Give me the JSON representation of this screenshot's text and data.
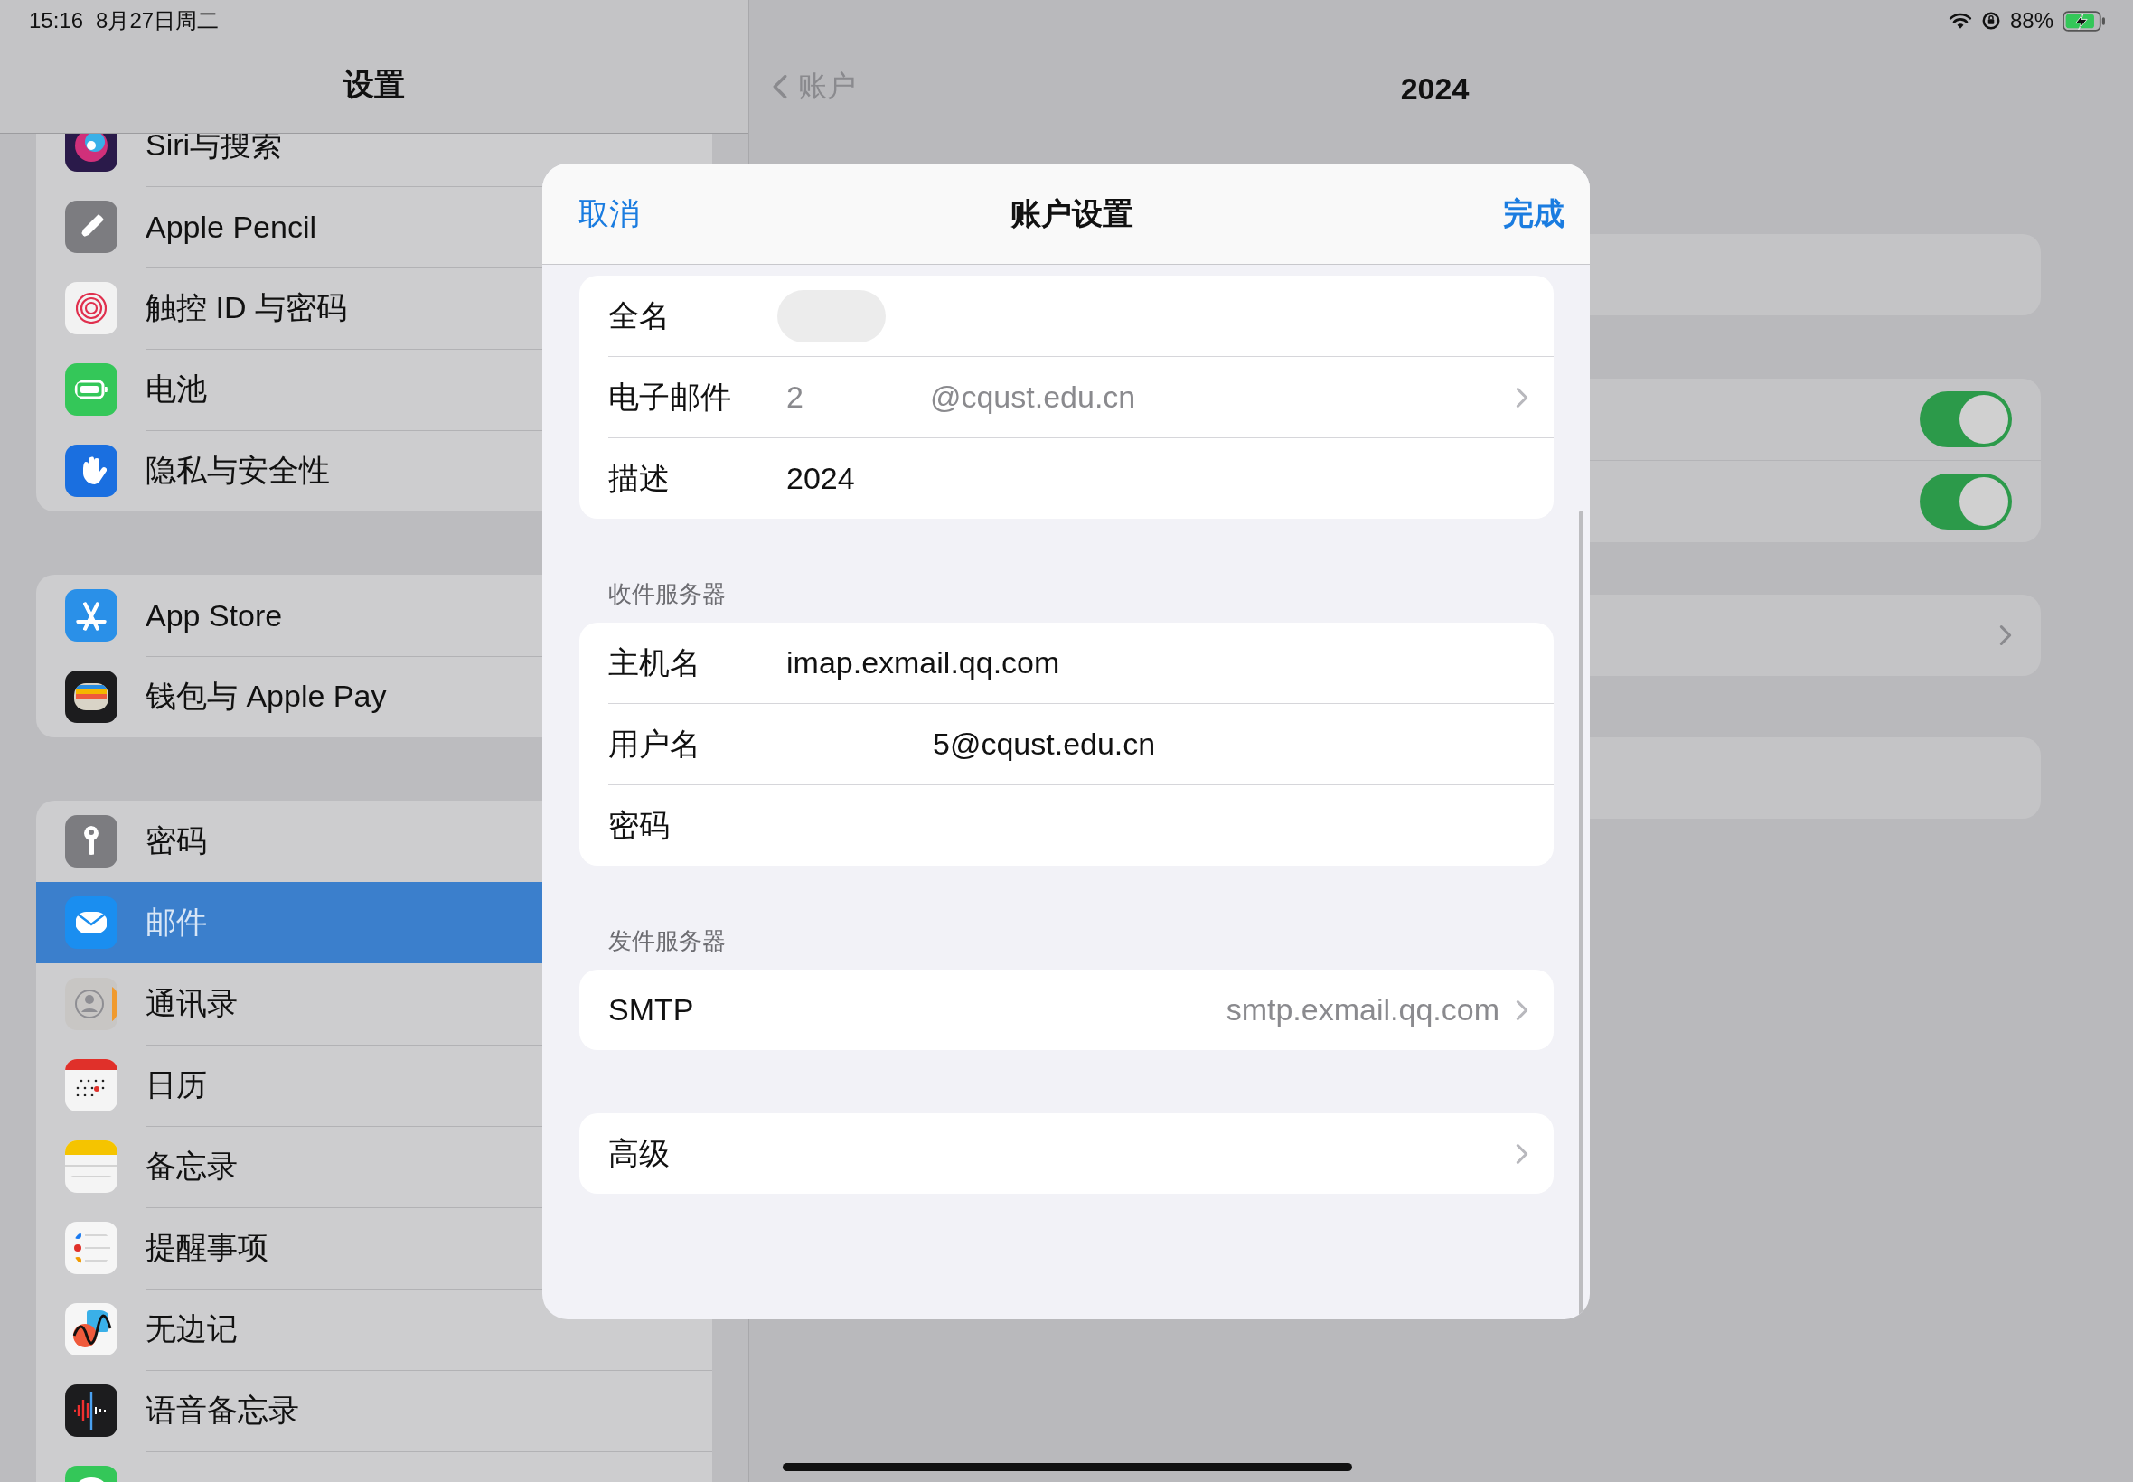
{
  "status_bar": {
    "time": "15:16",
    "date": "8月27日周二",
    "battery": "88%"
  },
  "sidebar": {
    "title": "设置",
    "groups": [
      {
        "items": [
          {
            "label": "Siri与搜索",
            "kind": "siri",
            "selected": false
          },
          {
            "label": "Apple Pencil",
            "kind": "pencil",
            "selected": false
          },
          {
            "label": "触控 ID 与密码",
            "kind": "touchid",
            "selected": false
          },
          {
            "label": "电池",
            "kind": "battery",
            "selected": false
          },
          {
            "label": "隐私与安全性",
            "kind": "privacy",
            "selected": false
          }
        ]
      },
      {
        "items": [
          {
            "label": "App Store",
            "kind": "appstore",
            "selected": false
          },
          {
            "label": "钱包与 Apple Pay",
            "kind": "wallet",
            "selected": false
          }
        ]
      },
      {
        "items": [
          {
            "label": "密码",
            "kind": "key",
            "selected": false
          },
          {
            "label": "邮件",
            "kind": "mail",
            "selected": true
          },
          {
            "label": "通讯录",
            "kind": "contacts",
            "selected": false
          },
          {
            "label": "日历",
            "kind": "calendar",
            "selected": false
          },
          {
            "label": "备忘录",
            "kind": "notes",
            "selected": false
          },
          {
            "label": "提醒事项",
            "kind": "reminders",
            "selected": false
          },
          {
            "label": "无边记",
            "kind": "freeform",
            "selected": false
          },
          {
            "label": "语音备忘录",
            "kind": "voice",
            "selected": false
          },
          {
            "kind": "messages",
            "selected": false
          }
        ]
      }
    ]
  },
  "detail": {
    "back": "账户",
    "title": "2024",
    "cards": [
      {
        "kind": "plain"
      },
      {
        "kind": "toggles",
        "toggles": [
          {
            "on": true
          },
          {
            "on": true
          }
        ]
      },
      {
        "kind": "link"
      },
      {
        "kind": "plain"
      }
    ]
  },
  "modal": {
    "cancel": "取消",
    "title": "账户设置",
    "done": "完成",
    "sections": [
      {
        "rows": [
          {
            "kind": "redacted",
            "label": "全名"
          },
          {
            "kind": "detail",
            "label": "电子邮件",
            "parts": [
              "2",
              "@cqust.edu.cn"
            ]
          },
          {
            "kind": "field",
            "label": "描述",
            "parts": [
              "2024"
            ]
          }
        ]
      },
      {
        "header": "收件服务器",
        "rows": [
          {
            "kind": "field",
            "label": "主机名",
            "parts": [
              "imap.exmail.qq.com"
            ]
          },
          {
            "kind": "partial_field",
            "label": "用户名",
            "parts": [
              "5@cqust.edu.cn"
            ]
          },
          {
            "kind": "field",
            "label": "密码"
          }
        ]
      },
      {
        "header": "发件服务器",
        "rows": [
          {
            "kind": "value_right",
            "label": "SMTP",
            "parts": [
              "smtp.exmail.qq.com"
            ]
          }
        ]
      },
      {
        "rows": [
          {
            "kind": "nav",
            "label": "高级"
          }
        ]
      }
    ]
  }
}
